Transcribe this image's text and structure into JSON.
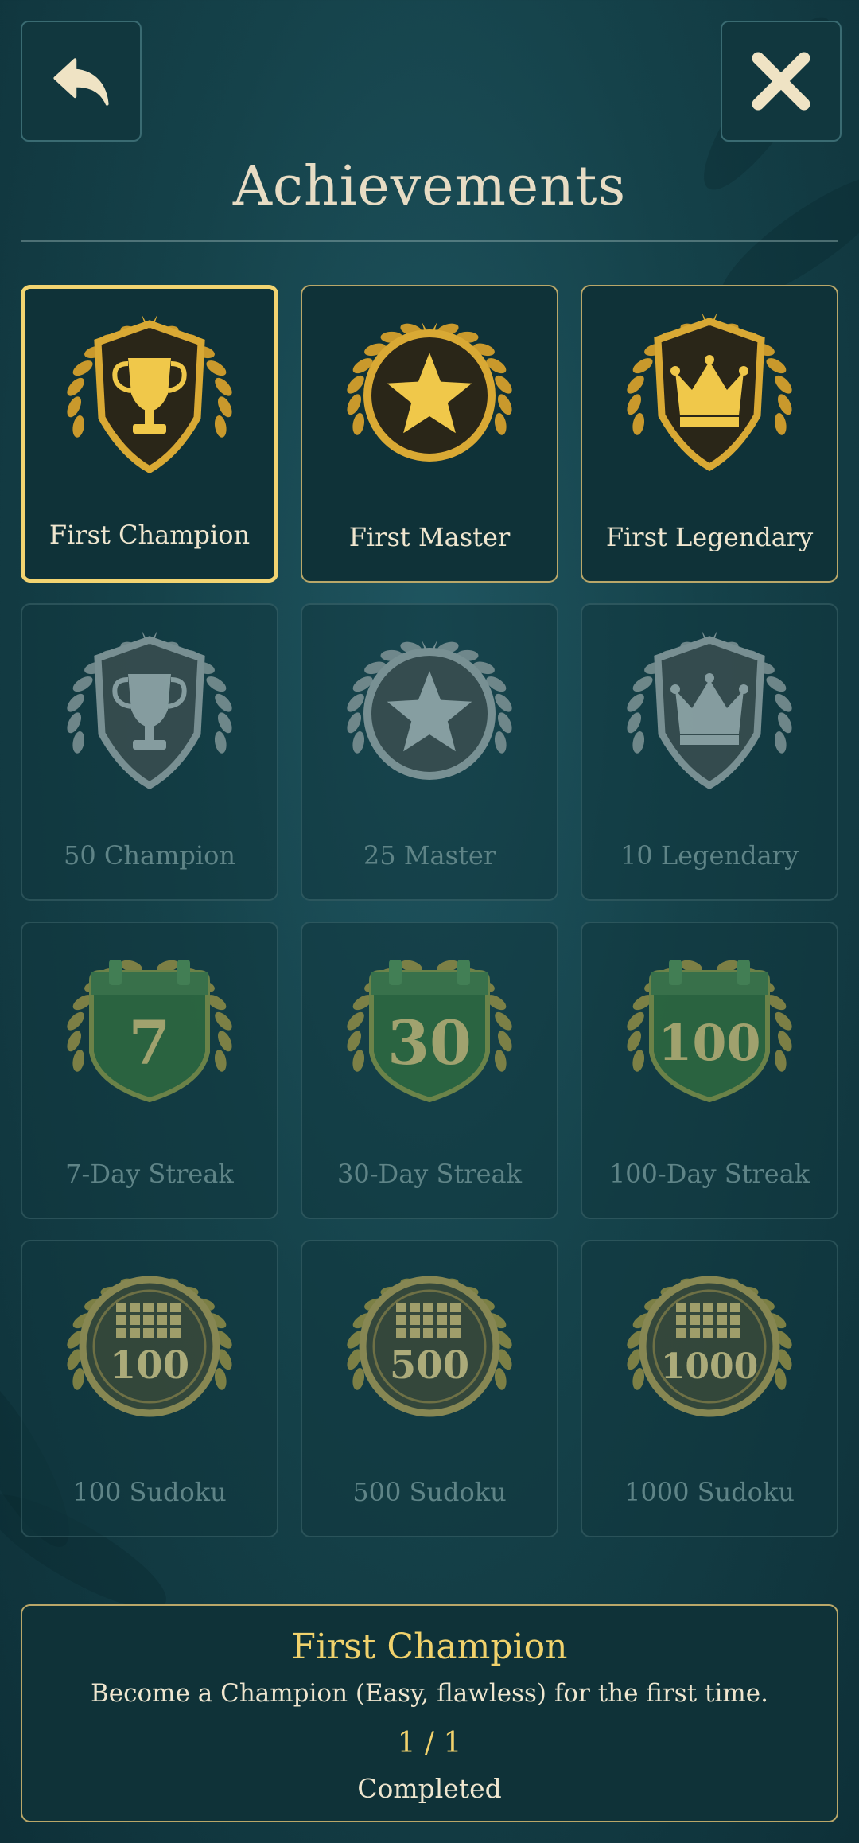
{
  "header": {
    "back_icon": "back-arrow-icon",
    "close_icon": "close-x-icon",
    "title": "Achievements"
  },
  "colors": {
    "gold": "#f1d26c",
    "selected_border": "#f2d471",
    "card_bg": "#0f3238",
    "locked_text": "#5f8487",
    "streak_green": "#2f6b40"
  },
  "achievements": [
    {
      "label": "First Champion",
      "icon": "trophy-shield-icon",
      "unlocked": true,
      "selected": true
    },
    {
      "label": "First Master",
      "icon": "star-medal-icon",
      "unlocked": true,
      "selected": false
    },
    {
      "label": "First Legendary",
      "icon": "crown-shield-icon",
      "unlocked": true,
      "selected": false
    },
    {
      "label": "50 Champion",
      "icon": "trophy-shield-icon",
      "unlocked": false,
      "selected": false
    },
    {
      "label": "25 Master",
      "icon": "star-medal-icon",
      "unlocked": false,
      "selected": false
    },
    {
      "label": "10 Legendary",
      "icon": "crown-shield-icon",
      "unlocked": false,
      "selected": false
    },
    {
      "label": "7-Day Streak",
      "icon": "calendar-badge-icon",
      "badge_text": "7",
      "unlocked": false,
      "selected": false
    },
    {
      "label": "30-Day Streak",
      "icon": "calendar-badge-icon",
      "badge_text": "30",
      "unlocked": false,
      "selected": false
    },
    {
      "label": "100-Day Streak",
      "icon": "calendar-badge-icon",
      "badge_text": "100",
      "unlocked": false,
      "selected": false
    },
    {
      "label": "100 Sudoku",
      "icon": "grid-medal-icon",
      "badge_text": "100",
      "unlocked": false,
      "selected": false
    },
    {
      "label": "500 Sudoku",
      "icon": "grid-medal-icon",
      "badge_text": "500",
      "unlocked": false,
      "selected": false
    },
    {
      "label": "1000 Sudoku",
      "icon": "grid-medal-icon",
      "badge_text": "1000",
      "unlocked": false,
      "selected": false
    }
  ],
  "detail": {
    "title": "First Champion",
    "description": "Become a Champion (Easy, flawless) for the first time.",
    "progress": "1 / 1",
    "status": "Completed"
  }
}
